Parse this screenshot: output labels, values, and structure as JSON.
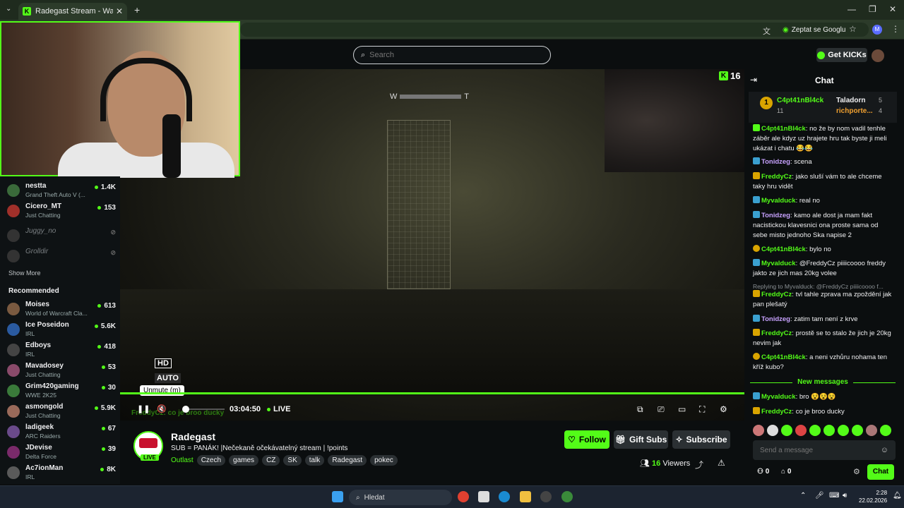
{
  "browser": {
    "tab_title": "Radegast Stream - Watch Live o",
    "ask_google": "Zeptat se Googlu",
    "profile_initial": "M"
  },
  "header": {
    "search_placeholder": "Search",
    "get_kicks": "Get KICKs"
  },
  "sidebar": {
    "following": [
      {
        "name": "nestta",
        "game": "Grand Theft Auto V (...",
        "viewers": "1.4K",
        "online": true
      },
      {
        "name": "Cicero_MT",
        "game": "Just Chatting",
        "viewers": "153",
        "online": true
      },
      {
        "name": "Juggy_no",
        "game": "",
        "viewers": "",
        "online": false
      },
      {
        "name": "Grolldir",
        "game": "",
        "viewers": "",
        "online": false
      }
    ],
    "show_more": "Show More",
    "recommended_title": "Recommended",
    "recommended": [
      {
        "name": "Moises",
        "game": "World of Warcraft Cla...",
        "viewers": "613"
      },
      {
        "name": "Ice Poseidon",
        "game": "IRL",
        "viewers": "5.6K"
      },
      {
        "name": "Edboys",
        "game": "IRL",
        "viewers": "418"
      },
      {
        "name": "Mavadosey",
        "game": "Just Chatting",
        "viewers": "53"
      },
      {
        "name": "Grim420gaming",
        "game": "WWE 2K25",
        "viewers": "30"
      },
      {
        "name": "asmongold",
        "game": "Just Chatting",
        "viewers": "5.9K"
      },
      {
        "name": "ladigeek",
        "game": "ARC Raiders",
        "viewers": "67"
      },
      {
        "name": "JDevise",
        "game": "Delta Force",
        "viewers": "39"
      },
      {
        "name": "Ac7ionMan",
        "game": "IRL",
        "viewers": "8K"
      }
    ]
  },
  "video": {
    "compass_w": "W",
    "compass_t": "T",
    "kick_count": "16",
    "hd": "HD",
    "auto": "AUTO",
    "tooltip": "Unmute (m)",
    "time": "03:04:50",
    "live": "LIVE",
    "ghost_text": "FreddyCz: co je broo ducky",
    "progress": 1.0
  },
  "stream": {
    "name": "Radegast",
    "live_badge": "LIVE",
    "title": "SUB = PANÁK! |Nečekaně očekávatelný stream | !points",
    "category": "Outlast",
    "tags": [
      "Czech",
      "games",
      "CZ",
      "SK",
      "talk",
      "Radegast",
      "pokec"
    ],
    "follow": "Follow",
    "gift_subs": "Gift Subs",
    "subscribe": "Subscribe",
    "viewers_count": "16",
    "viewers_label": "Viewers"
  },
  "chat": {
    "title": "Chat",
    "leaderboard": {
      "first": {
        "name": "C4pt41nBl4ck",
        "value": "11"
      },
      "second": {
        "name": "Taladorn",
        "value": "5"
      },
      "third": {
        "name": "richporte...",
        "value": "4"
      }
    },
    "messages": [
      {
        "user": "C4pt41nBl4ck",
        "color": "#53fc18",
        "text": "no že by nom vadil tenhle záběr ale kdyz uz hrajete hru tak byste ji meli ukázat i chatu 😂😂"
      },
      {
        "user": "Tonidzeg",
        "color": "#c8a2ff",
        "text": "scena"
      },
      {
        "user": "FreddyCz",
        "color": "#53fc18",
        "text": "jako sluší vám to ale chceme taky hru vidět"
      },
      {
        "user": "Myvalduck",
        "color": "#53fc18",
        "text": "real no"
      },
      {
        "user": "Tonidzeg",
        "color": "#c8a2ff",
        "text": "kamo ale dost ja mam fakt nacistickou klavesnici ona proste sama od sebe misto jednoho Ska napise 2"
      },
      {
        "user": "C4pt41nBl4ck",
        "color": "#53fc18",
        "text": "bylo no"
      },
      {
        "user": "Myvalduck",
        "color": "#53fc18",
        "text": "@FreddyCz piiiicoooo freddy jakto ze jich mas 20kg volee"
      },
      {
        "user": "FreddyCz",
        "color": "#53fc18",
        "text": "tvl tahle zprava ma zpoždění jak pan plešatý",
        "reply": "Replying to Myvalduck: @FreddyCz piiiicoooo f..."
      },
      {
        "user": "Tonidzeg",
        "color": "#c8a2ff",
        "text": "zatim tam není z krve"
      },
      {
        "user": "FreddyCz",
        "color": "#53fc18",
        "text": "prostě se to stalo že jich je 20kg nevim jak"
      },
      {
        "user": "C4pt41nBl4ck",
        "color": "#53fc18",
        "text": "a neni vzhůru nohama ten kříž kubo?"
      }
    ],
    "new_messages": "New messages",
    "after": [
      {
        "user": "Myvalduck",
        "color": "#53fc18",
        "text": "bro 😵😵😵"
      },
      {
        "user": "FreddyCz",
        "color": "#53fc18",
        "text": "co je broo ducky"
      }
    ],
    "input_placeholder": "Send a message",
    "points_a": "0",
    "points_b": "0",
    "send": "Chat"
  },
  "taskbar": {
    "search": "Hledat",
    "time": "2:28",
    "date": "22.02.2026"
  },
  "colors": {
    "accent": "#53fc18",
    "bg": "#0b0e0f",
    "panel": "#2b3033"
  }
}
